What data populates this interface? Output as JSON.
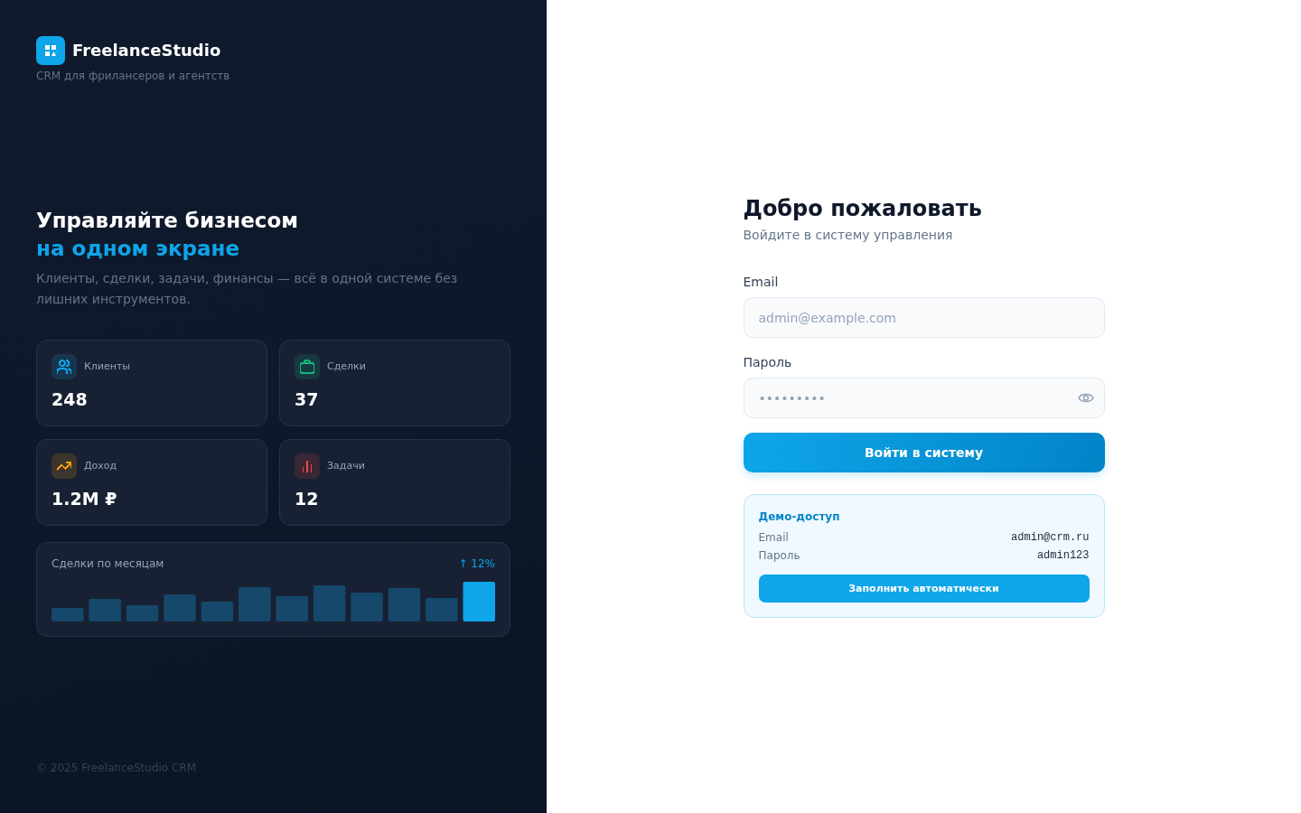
{
  "brand": {
    "name": "FreelanceStudio",
    "tagline": "CRM для фрилансеров и агентств"
  },
  "hero": {
    "title": "Управляйте бизнесом",
    "title_accent": "на одном экране",
    "description": "Клиенты, сделки, задачи, финансы — всё в одной системе без лишних инструментов."
  },
  "stats": [
    {
      "kind": "clients",
      "label": "Клиенты",
      "value": "248",
      "color": "#0ea5e9"
    },
    {
      "kind": "deals",
      "label": "Сделки",
      "value": "37",
      "color": "#10b981"
    },
    {
      "kind": "income",
      "label": "Доход",
      "value": "1.2M ₽",
      "color": "#f59e0b"
    },
    {
      "kind": "tasks",
      "label": "Задачи",
      "value": "12",
      "color": "#ef4444"
    }
  ],
  "deals_chart": {
    "title": "Сделки по месяцам",
    "trend": "↑ 12%"
  },
  "footer": "© 2025 FreelanceStudio CRM",
  "login": {
    "title": "Добро пожаловать",
    "subtitle": "Войдите в систему управления",
    "fields": [
      {
        "kind": "email",
        "label": "Email",
        "placeholder": "admin@example.com"
      },
      {
        "kind": "password",
        "label": "Пароль",
        "placeholder": "•••••••••"
      }
    ],
    "submit": "Войти в систему"
  },
  "demo": {
    "title": "Демо-доступ",
    "rows": [
      {
        "label": "Email",
        "value": "admin@crm.ru"
      },
      {
        "label": "Пароль",
        "value": "admin123"
      }
    ],
    "button": "Заполнить автоматически"
  }
}
